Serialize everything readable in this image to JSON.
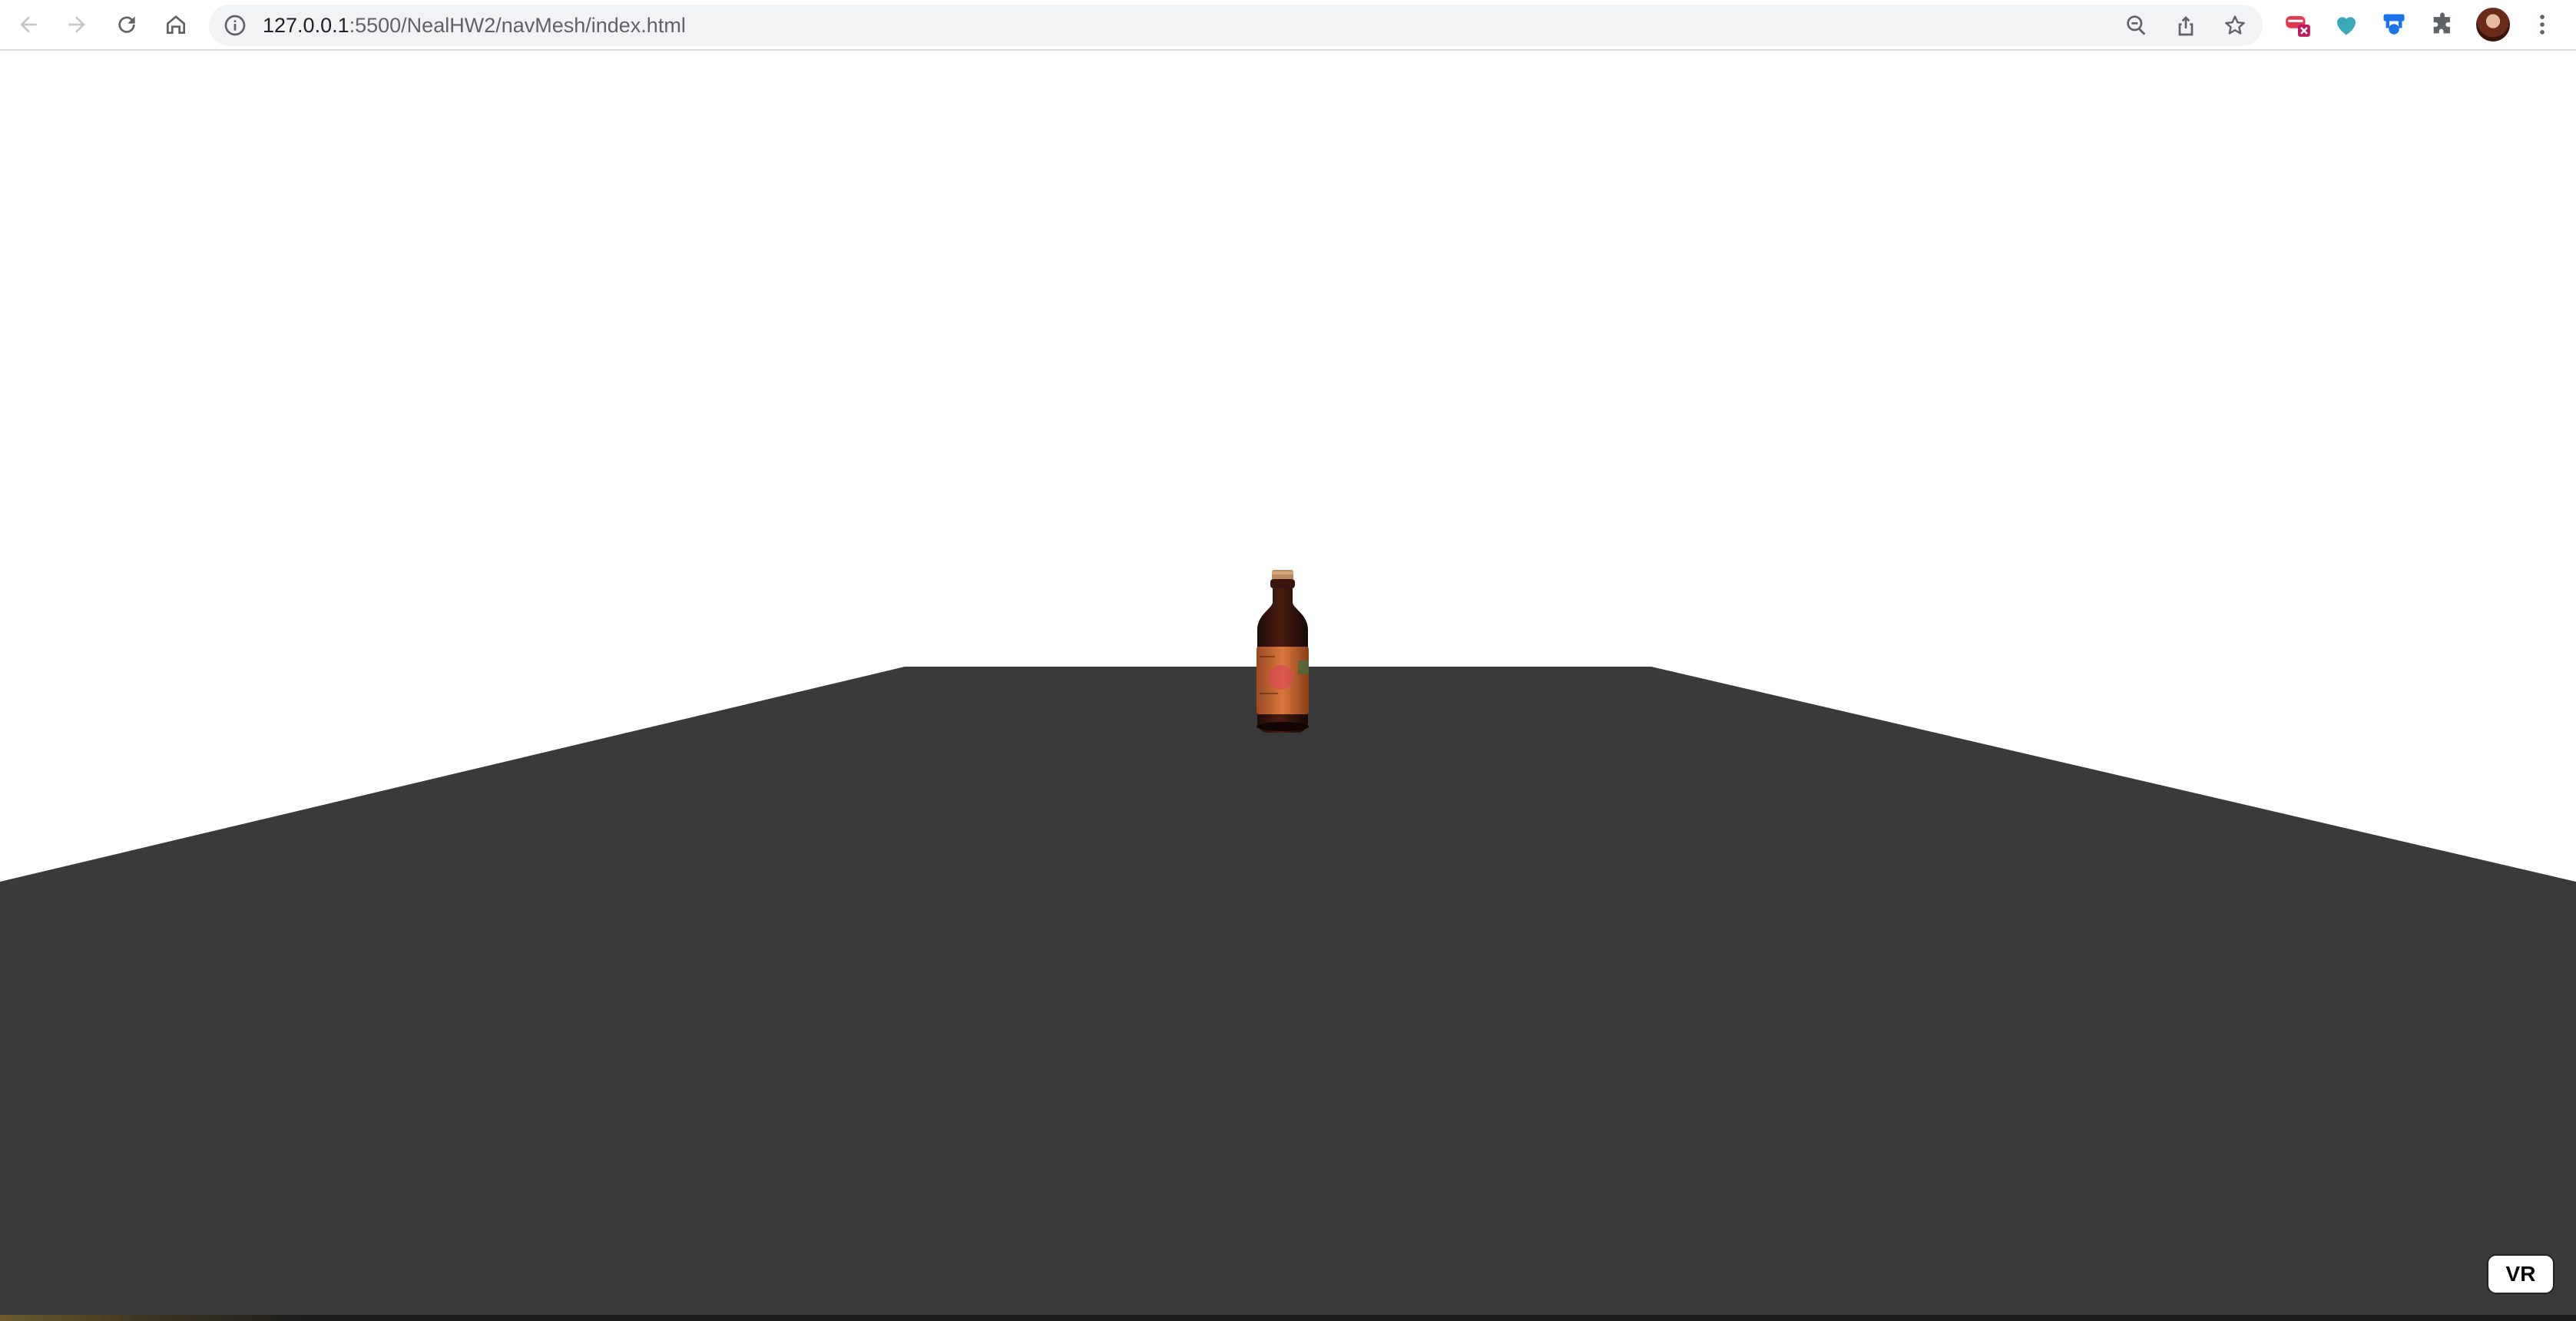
{
  "browser": {
    "url_host": "127.0.0.1",
    "url_rest": ":5500/NealHW2/navMesh/index.html",
    "icons": {
      "back": "back-arrow-icon",
      "forward": "forward-arrow-icon",
      "reload": "reload-icon",
      "home": "home-icon",
      "site_info": "info-icon",
      "zoom": "zoom-out-icon",
      "share": "share-icon",
      "bookmark": "star-icon",
      "extensions": [
        "extension-red-icon",
        "extension-heart-icon",
        "extension-blue-icon",
        "puzzle-icon"
      ],
      "profile": "avatar",
      "menu": "kebab-menu-icon"
    }
  },
  "scene": {
    "floor_color": "#3a3a3a",
    "sky_color": "#ffffff",
    "object": "bottle"
  },
  "vr_button": {
    "label": "VR"
  }
}
